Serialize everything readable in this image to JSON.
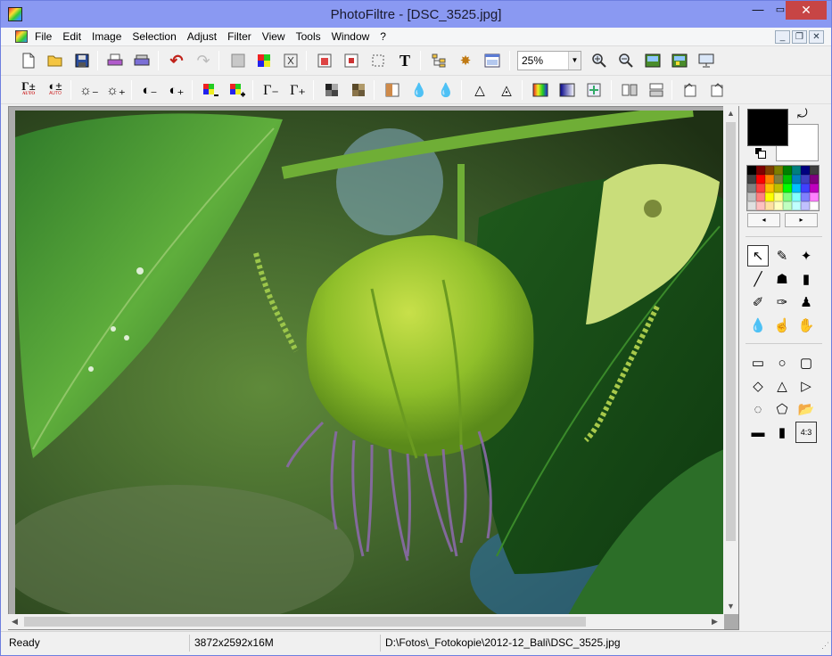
{
  "window": {
    "title": "PhotoFiltre - [DSC_3525.jpg]",
    "minimize": "—",
    "maximize": "▭",
    "close": "✕"
  },
  "menu": {
    "items": [
      "File",
      "Edit",
      "Image",
      "Selection",
      "Adjust",
      "Filter",
      "View",
      "Tools",
      "Window",
      "?"
    ]
  },
  "mdi_controls": [
    "_",
    "❐",
    "✕"
  ],
  "toolbar1": {
    "icons": [
      "new-icon",
      "open-icon",
      "save-icon",
      "print-icon",
      "scan-icon",
      "undo-icon",
      "redo-icon",
      "fade-icon",
      "color-grid-icon",
      "transform-icon",
      "image-size-icon",
      "canvas-size-icon",
      "crop-selection-icon",
      "text-icon",
      "plugin-tree-icon",
      "automate-icon",
      "browser-icon",
      "zoom-in-icon",
      "zoom-out-icon",
      "fit-image-icon",
      "actual-size-icon",
      "fullscreen-icon"
    ],
    "zoom_value": "25%"
  },
  "toolbar2": {
    "icons": [
      "auto-levels-icon",
      "auto-contrast-icon",
      "brightness-down-icon",
      "brightness-up-icon",
      "contrast-down-icon",
      "contrast-up-icon",
      "saturation-down-icon",
      "saturation-up-icon",
      "gamma-down-icon",
      "gamma-up-icon",
      "grayscale-icon",
      "sepia-icon",
      "equalize-icon",
      "blur-icon",
      "sharpen-icon",
      "soften-icon",
      "accentuate-icon",
      "gradient-icon",
      "bw-gradient-icon",
      "motion-icon",
      "flip-horizontal-icon",
      "flip-vertical-icon",
      "rotate-left-icon",
      "rotate-right-icon"
    ]
  },
  "palette": {
    "foreground": "#000000",
    "background": "#ffffff",
    "nav_left": "◂",
    "nav_right": "▸",
    "swatches": [
      "#000000",
      "#7f0000",
      "#7f3f00",
      "#7f7f00",
      "#007f00",
      "#007f7f",
      "#00007f",
      "#3f3f3f",
      "#404040",
      "#ff0000",
      "#ff7f00",
      "#7f7f3f",
      "#00bf00",
      "#007fbf",
      "#3f3fbf",
      "#7f007f",
      "#808080",
      "#ff4040",
      "#ffbf00",
      "#bfbf00",
      "#00ff00",
      "#00bfff",
      "#4040ff",
      "#bf00bf",
      "#c0c0c0",
      "#ff8080",
      "#ffff00",
      "#ffff80",
      "#80ff80",
      "#80ffff",
      "#8080ff",
      "#ff80ff",
      "#e0e0e0",
      "#ffc0c0",
      "#ffe0a0",
      "#ffffc0",
      "#c0ffc0",
      "#c0ffff",
      "#c0c0ff",
      "#ffffff"
    ]
  },
  "tools": [
    {
      "name": "pointer-tool",
      "glyph": "↖",
      "selected": true
    },
    {
      "name": "color-picker-tool",
      "glyph": "✎"
    },
    {
      "name": "magic-wand-tool",
      "glyph": "✦"
    },
    {
      "name": "line-tool",
      "glyph": "╱"
    },
    {
      "name": "fill-tool",
      "glyph": "☗"
    },
    {
      "name": "spray-tool",
      "glyph": "▮"
    },
    {
      "name": "brush-tool",
      "glyph": "✐"
    },
    {
      "name": "advanced-brush-tool",
      "glyph": "✑"
    },
    {
      "name": "stamp-tool",
      "glyph": "♟"
    },
    {
      "name": "blur-drop-tool",
      "glyph": "💧"
    },
    {
      "name": "smudge-tool",
      "glyph": "☝"
    },
    {
      "name": "hand-tool",
      "glyph": "✋"
    }
  ],
  "shapes": [
    {
      "name": "rectangle-shape",
      "glyph": "▭"
    },
    {
      "name": "ellipse-shape",
      "glyph": "○"
    },
    {
      "name": "rounded-rect-shape",
      "glyph": "▢"
    },
    {
      "name": "diamond-shape",
      "glyph": "◇"
    },
    {
      "name": "triangle-shape",
      "glyph": "△"
    },
    {
      "name": "right-triangle-shape",
      "glyph": "▷"
    },
    {
      "name": "lasso-shape",
      "glyph": "◌"
    },
    {
      "name": "polygon-shape",
      "glyph": "⬠"
    },
    {
      "name": "open-shape",
      "glyph": "📂"
    },
    {
      "name": "horizontal-select",
      "glyph": "▬"
    },
    {
      "name": "vertical-select",
      "glyph": "▮"
    },
    {
      "name": "ratio-select",
      "glyph": "4:3"
    }
  ],
  "status": {
    "state": "Ready",
    "dimensions": "3872x2592x16M",
    "path": "D:\\Fotos\\_Fotokopie\\2012-12_Bali\\DSC_3525.jpg"
  },
  "scrollbars": {
    "up": "▲",
    "down": "▼",
    "left": "◀",
    "right": "▶"
  }
}
